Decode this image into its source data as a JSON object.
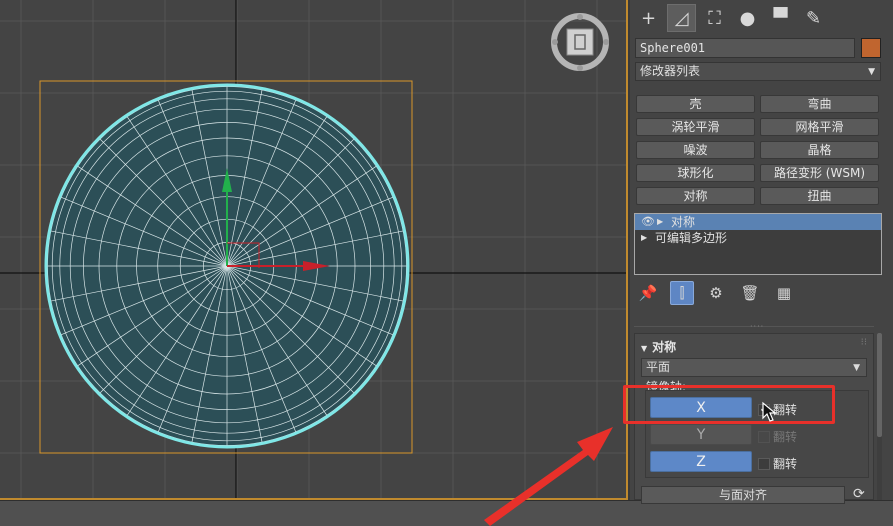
{
  "panel_tabs": [
    {
      "icon": "plus-icon",
      "glyph": "+"
    },
    {
      "icon": "modify-icon",
      "glyph": "◿"
    },
    {
      "icon": "hierarchy-icon",
      "glyph": "⛶"
    },
    {
      "icon": "motion-icon",
      "glyph": "●"
    },
    {
      "icon": "display-icon",
      "glyph": "▀"
    },
    {
      "icon": "utilities-icon",
      "glyph": "✎"
    }
  ],
  "object_name": "Sphere001",
  "object_color": "#c0652f",
  "modifier_list_label": "修改器列表",
  "modifier_buttons": [
    "壳",
    "弯曲",
    "涡轮平滑",
    "网格平滑",
    "噪波",
    "晶格",
    "球形化",
    "路径变形 (WSM)",
    "对称",
    "扭曲"
  ],
  "stack": [
    {
      "label": "对称",
      "selected": true
    },
    {
      "label": "可编辑多边形",
      "selected": false
    }
  ],
  "rollout": {
    "title": "对称",
    "plane_value": "平面",
    "mirror_axis_label": "镜像轴:",
    "axes": [
      {
        "label": "X",
        "active": true,
        "flip_label": "翻转",
        "flip_checked": true,
        "flip_enabled": true
      },
      {
        "label": "Y",
        "active": false,
        "flip_label": "翻转",
        "flip_checked": false,
        "flip_enabled": false
      },
      {
        "label": "Z",
        "active": true,
        "flip_label": "翻转",
        "flip_checked": false,
        "flip_enabled": true
      }
    ],
    "align_button": "与面对齐"
  },
  "colors": {
    "accent": "#5d88c8",
    "selection_outline": "#7fe7e7",
    "bbox": "#d9962a",
    "highlight": "#e8302a",
    "sphere_fill": "#2c4f57"
  }
}
